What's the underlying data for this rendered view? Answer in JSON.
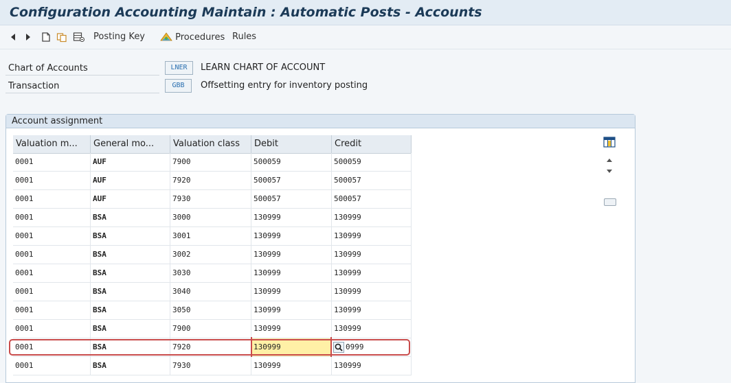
{
  "title": "Configuration Accounting Maintain : Automatic Posts - Accounts",
  "toolbar": {
    "posting_key": "Posting Key",
    "procedures": "Procedures",
    "rules": "Rules"
  },
  "header": {
    "chart_label": "Chart of Accounts",
    "chart_code": "LNER",
    "chart_desc": "LEARN CHART OF ACCOUNT",
    "transaction_label": "Transaction",
    "transaction_code": "GBB",
    "transaction_desc": "Offsetting entry for inventory posting"
  },
  "group": {
    "title": "Account assignment"
  },
  "table": {
    "columns": [
      "Valuation m...",
      "General mo...",
      "Valuation class",
      "Debit",
      "Credit"
    ],
    "rows": [
      [
        "0001",
        "AUF",
        "7900",
        "500059",
        "500059"
      ],
      [
        "0001",
        "AUF",
        "7920",
        "500057",
        "500057"
      ],
      [
        "0001",
        "AUF",
        "7930",
        "500057",
        "500057"
      ],
      [
        "0001",
        "BSA",
        "3000",
        "130999",
        "130999"
      ],
      [
        "0001",
        "BSA",
        "3001",
        "130999",
        "130999"
      ],
      [
        "0001",
        "BSA",
        "3002",
        "130999",
        "130999"
      ],
      [
        "0001",
        "BSA",
        "3030",
        "130999",
        "130999"
      ],
      [
        "0001",
        "BSA",
        "3040",
        "130999",
        "130999"
      ],
      [
        "0001",
        "BSA",
        "3050",
        "130999",
        "130999"
      ],
      [
        "0001",
        "BSA",
        "7900",
        "130999",
        "130999"
      ],
      [
        "0001",
        "BSA",
        "7920",
        "130999",
        "0999"
      ],
      [
        "0001",
        "BSA",
        "7930",
        "130999",
        "130999"
      ]
    ]
  },
  "icons": {
    "back": "left-arrow-icon",
    "forward": "right-arrow-icon",
    "new": "new-document-icon",
    "copy": "copy-icon",
    "delete": "delete-icon",
    "procedures": "procedures-icon",
    "column_settings": "column-settings-icon",
    "search_help": "search-icon"
  },
  "colors": {
    "title": "#1b3a57",
    "highlight": "#c84b4b",
    "focus_cell": "#fff0a6",
    "code_text": "#2a6fb0"
  }
}
